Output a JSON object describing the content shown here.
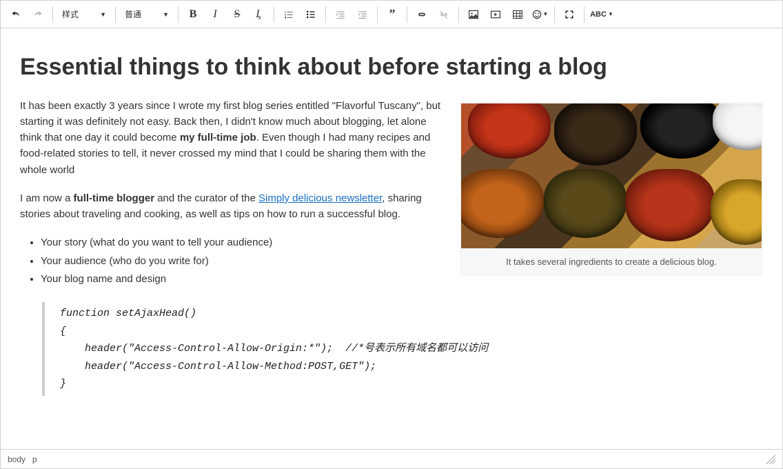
{
  "toolbar": {
    "styles_label": "样式",
    "format_label": "普通"
  },
  "title": "Essential things to think about before starting a blog",
  "p1": {
    "part1": "It has been exactly 3 years since I wrote my first blog series entitled \"Flavorful Tuscany\", but starting it was definitely not easy. Back then, I didn't know much about blogging, let alone think that one day it could become ",
    "bold1": "my full-time job",
    "part2": ". Even though I had many recipes and food-related stories to tell, it never crossed my mind that I could be sharing them with the whole world"
  },
  "p2": {
    "part1": "I am now a ",
    "bold1": "full-time blogger",
    "part2": " and the curator of the ",
    "link1": "Simply delicious newsletter",
    "part3": ", sharing stories about traveling and cooking, as well as tips on how to run a successful blog."
  },
  "figure_caption": "It takes several ingredients to create a delicious blog.",
  "list": {
    "item1": "Your story (what do you want to tell your audience)",
    "item2": "Your audience (who do you write for)",
    "item3": "Your blog name and design"
  },
  "code": "function setAjaxHead()\n{\n    header(\"Access-Control-Allow-Origin:*\");  //*号表示所有域名都可以访问\n    header(\"Access-Control-Allow-Method:POST,GET\");\n}",
  "path": {
    "seg1": "body",
    "seg2": "p"
  }
}
